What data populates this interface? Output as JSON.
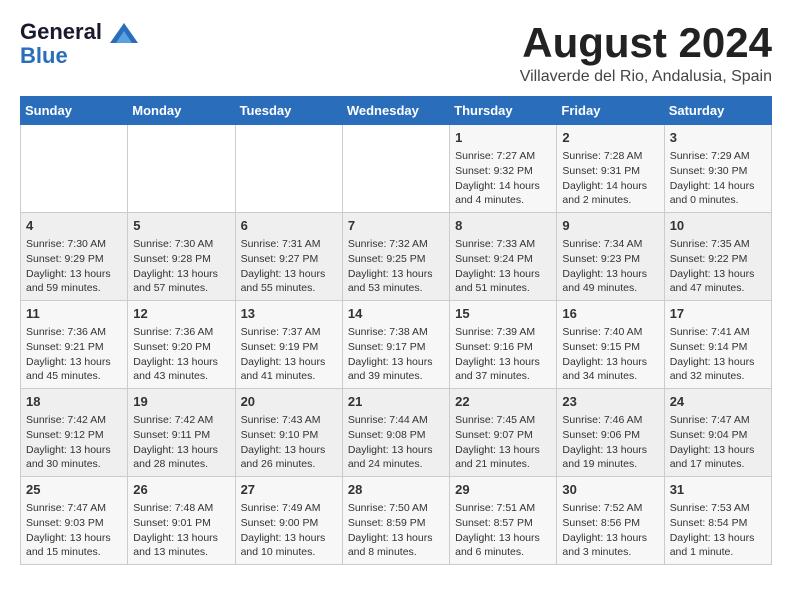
{
  "header": {
    "logo_line1": "General",
    "logo_line2": "Blue",
    "title": "August 2024",
    "subtitle": "Villaverde del Rio, Andalusia, Spain"
  },
  "weekdays": [
    "Sunday",
    "Monday",
    "Tuesday",
    "Wednesday",
    "Thursday",
    "Friday",
    "Saturday"
  ],
  "weeks": [
    [
      {
        "day": "",
        "info": ""
      },
      {
        "day": "",
        "info": ""
      },
      {
        "day": "",
        "info": ""
      },
      {
        "day": "",
        "info": ""
      },
      {
        "day": "1",
        "info": "Sunrise: 7:27 AM\nSunset: 9:32 PM\nDaylight: 14 hours\nand 4 minutes."
      },
      {
        "day": "2",
        "info": "Sunrise: 7:28 AM\nSunset: 9:31 PM\nDaylight: 14 hours\nand 2 minutes."
      },
      {
        "day": "3",
        "info": "Sunrise: 7:29 AM\nSunset: 9:30 PM\nDaylight: 14 hours\nand 0 minutes."
      }
    ],
    [
      {
        "day": "4",
        "info": "Sunrise: 7:30 AM\nSunset: 9:29 PM\nDaylight: 13 hours\nand 59 minutes."
      },
      {
        "day": "5",
        "info": "Sunrise: 7:30 AM\nSunset: 9:28 PM\nDaylight: 13 hours\nand 57 minutes."
      },
      {
        "day": "6",
        "info": "Sunrise: 7:31 AM\nSunset: 9:27 PM\nDaylight: 13 hours\nand 55 minutes."
      },
      {
        "day": "7",
        "info": "Sunrise: 7:32 AM\nSunset: 9:25 PM\nDaylight: 13 hours\nand 53 minutes."
      },
      {
        "day": "8",
        "info": "Sunrise: 7:33 AM\nSunset: 9:24 PM\nDaylight: 13 hours\nand 51 minutes."
      },
      {
        "day": "9",
        "info": "Sunrise: 7:34 AM\nSunset: 9:23 PM\nDaylight: 13 hours\nand 49 minutes."
      },
      {
        "day": "10",
        "info": "Sunrise: 7:35 AM\nSunset: 9:22 PM\nDaylight: 13 hours\nand 47 minutes."
      }
    ],
    [
      {
        "day": "11",
        "info": "Sunrise: 7:36 AM\nSunset: 9:21 PM\nDaylight: 13 hours\nand 45 minutes."
      },
      {
        "day": "12",
        "info": "Sunrise: 7:36 AM\nSunset: 9:20 PM\nDaylight: 13 hours\nand 43 minutes."
      },
      {
        "day": "13",
        "info": "Sunrise: 7:37 AM\nSunset: 9:19 PM\nDaylight: 13 hours\nand 41 minutes."
      },
      {
        "day": "14",
        "info": "Sunrise: 7:38 AM\nSunset: 9:17 PM\nDaylight: 13 hours\nand 39 minutes."
      },
      {
        "day": "15",
        "info": "Sunrise: 7:39 AM\nSunset: 9:16 PM\nDaylight: 13 hours\nand 37 minutes."
      },
      {
        "day": "16",
        "info": "Sunrise: 7:40 AM\nSunset: 9:15 PM\nDaylight: 13 hours\nand 34 minutes."
      },
      {
        "day": "17",
        "info": "Sunrise: 7:41 AM\nSunset: 9:14 PM\nDaylight: 13 hours\nand 32 minutes."
      }
    ],
    [
      {
        "day": "18",
        "info": "Sunrise: 7:42 AM\nSunset: 9:12 PM\nDaylight: 13 hours\nand 30 minutes."
      },
      {
        "day": "19",
        "info": "Sunrise: 7:42 AM\nSunset: 9:11 PM\nDaylight: 13 hours\nand 28 minutes."
      },
      {
        "day": "20",
        "info": "Sunrise: 7:43 AM\nSunset: 9:10 PM\nDaylight: 13 hours\nand 26 minutes."
      },
      {
        "day": "21",
        "info": "Sunrise: 7:44 AM\nSunset: 9:08 PM\nDaylight: 13 hours\nand 24 minutes."
      },
      {
        "day": "22",
        "info": "Sunrise: 7:45 AM\nSunset: 9:07 PM\nDaylight: 13 hours\nand 21 minutes."
      },
      {
        "day": "23",
        "info": "Sunrise: 7:46 AM\nSunset: 9:06 PM\nDaylight: 13 hours\nand 19 minutes."
      },
      {
        "day": "24",
        "info": "Sunrise: 7:47 AM\nSunset: 9:04 PM\nDaylight: 13 hours\nand 17 minutes."
      }
    ],
    [
      {
        "day": "25",
        "info": "Sunrise: 7:47 AM\nSunset: 9:03 PM\nDaylight: 13 hours\nand 15 minutes."
      },
      {
        "day": "26",
        "info": "Sunrise: 7:48 AM\nSunset: 9:01 PM\nDaylight: 13 hours\nand 13 minutes."
      },
      {
        "day": "27",
        "info": "Sunrise: 7:49 AM\nSunset: 9:00 PM\nDaylight: 13 hours\nand 10 minutes."
      },
      {
        "day": "28",
        "info": "Sunrise: 7:50 AM\nSunset: 8:59 PM\nDaylight: 13 hours\nand 8 minutes."
      },
      {
        "day": "29",
        "info": "Sunrise: 7:51 AM\nSunset: 8:57 PM\nDaylight: 13 hours\nand 6 minutes."
      },
      {
        "day": "30",
        "info": "Sunrise: 7:52 AM\nSunset: 8:56 PM\nDaylight: 13 hours\nand 3 minutes."
      },
      {
        "day": "31",
        "info": "Sunrise: 7:53 AM\nSunset: 8:54 PM\nDaylight: 13 hours\nand 1 minute."
      }
    ]
  ]
}
